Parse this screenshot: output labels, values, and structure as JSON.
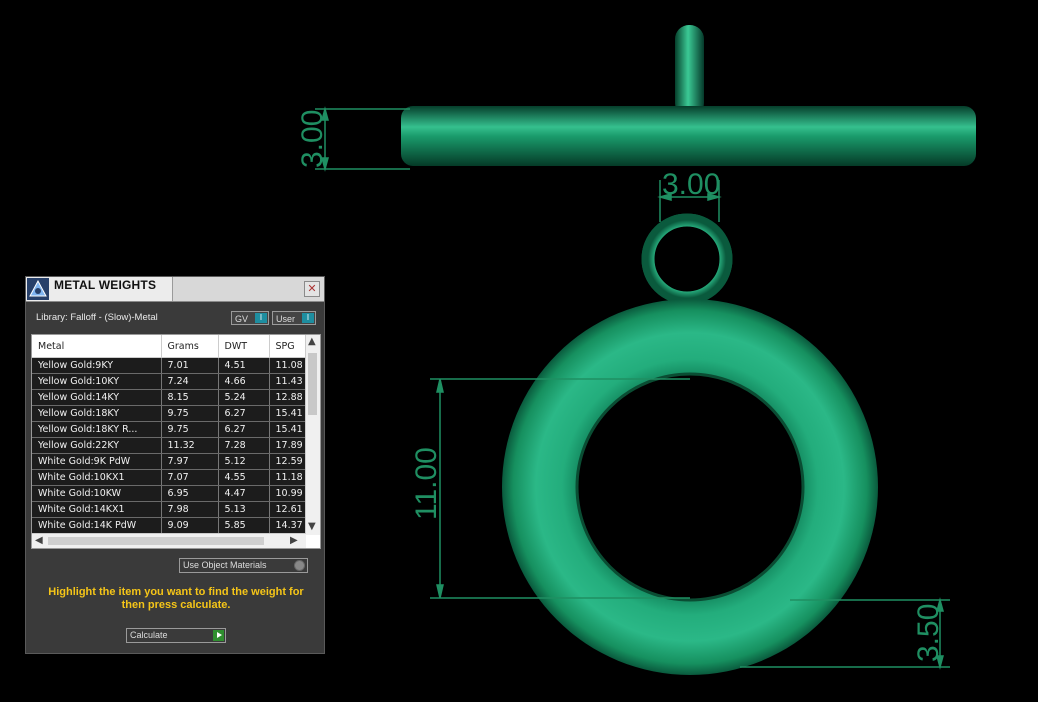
{
  "scene": {
    "dimensions": {
      "bar_thickness": "3.00",
      "ring_width": "3.00",
      "inner_diameter": "11.00",
      "band_width": "3.50"
    },
    "colors": {
      "metal": "#138a5f",
      "dimension_lines": "#1f8f62",
      "background": "#000000"
    }
  },
  "panel": {
    "title": "METAL WEIGHTS",
    "library_label": "Library: Falloff - (Slow)-Metal",
    "toggle_gv": "GV",
    "toggle_user": "User",
    "columns": [
      "Metal",
      "Grams",
      "DWT",
      "SPG"
    ],
    "rows": [
      [
        "Yellow Gold:9KY",
        "7.01",
        "4.51",
        "11.08"
      ],
      [
        "Yellow Gold:10KY",
        "7.24",
        "4.66",
        "11.43"
      ],
      [
        "Yellow Gold:14KY",
        "8.15",
        "5.24",
        "12.88"
      ],
      [
        "Yellow Gold:18KY",
        "9.75",
        "6.27",
        "15.41"
      ],
      [
        "Yellow Gold:18KY R...",
        "9.75",
        "6.27",
        "15.41"
      ],
      [
        "Yellow Gold:22KY",
        "11.32",
        "7.28",
        "17.89"
      ],
      [
        "White Gold:9K PdW",
        "7.97",
        "5.12",
        "12.59"
      ],
      [
        "White Gold:10KX1",
        "7.07",
        "4.55",
        "11.18"
      ],
      [
        "White Gold:10KW",
        "6.95",
        "4.47",
        "10.99"
      ],
      [
        "White Gold:14KX1",
        "7.98",
        "5.13",
        "12.61"
      ],
      [
        "White Gold:14K PdW",
        "9.09",
        "5.85",
        "14.37"
      ]
    ],
    "use_object_materials": "Use Object Materials",
    "hint": "Highlight the item you want to find the weight for then press calculate.",
    "calculate": "Calculate"
  }
}
